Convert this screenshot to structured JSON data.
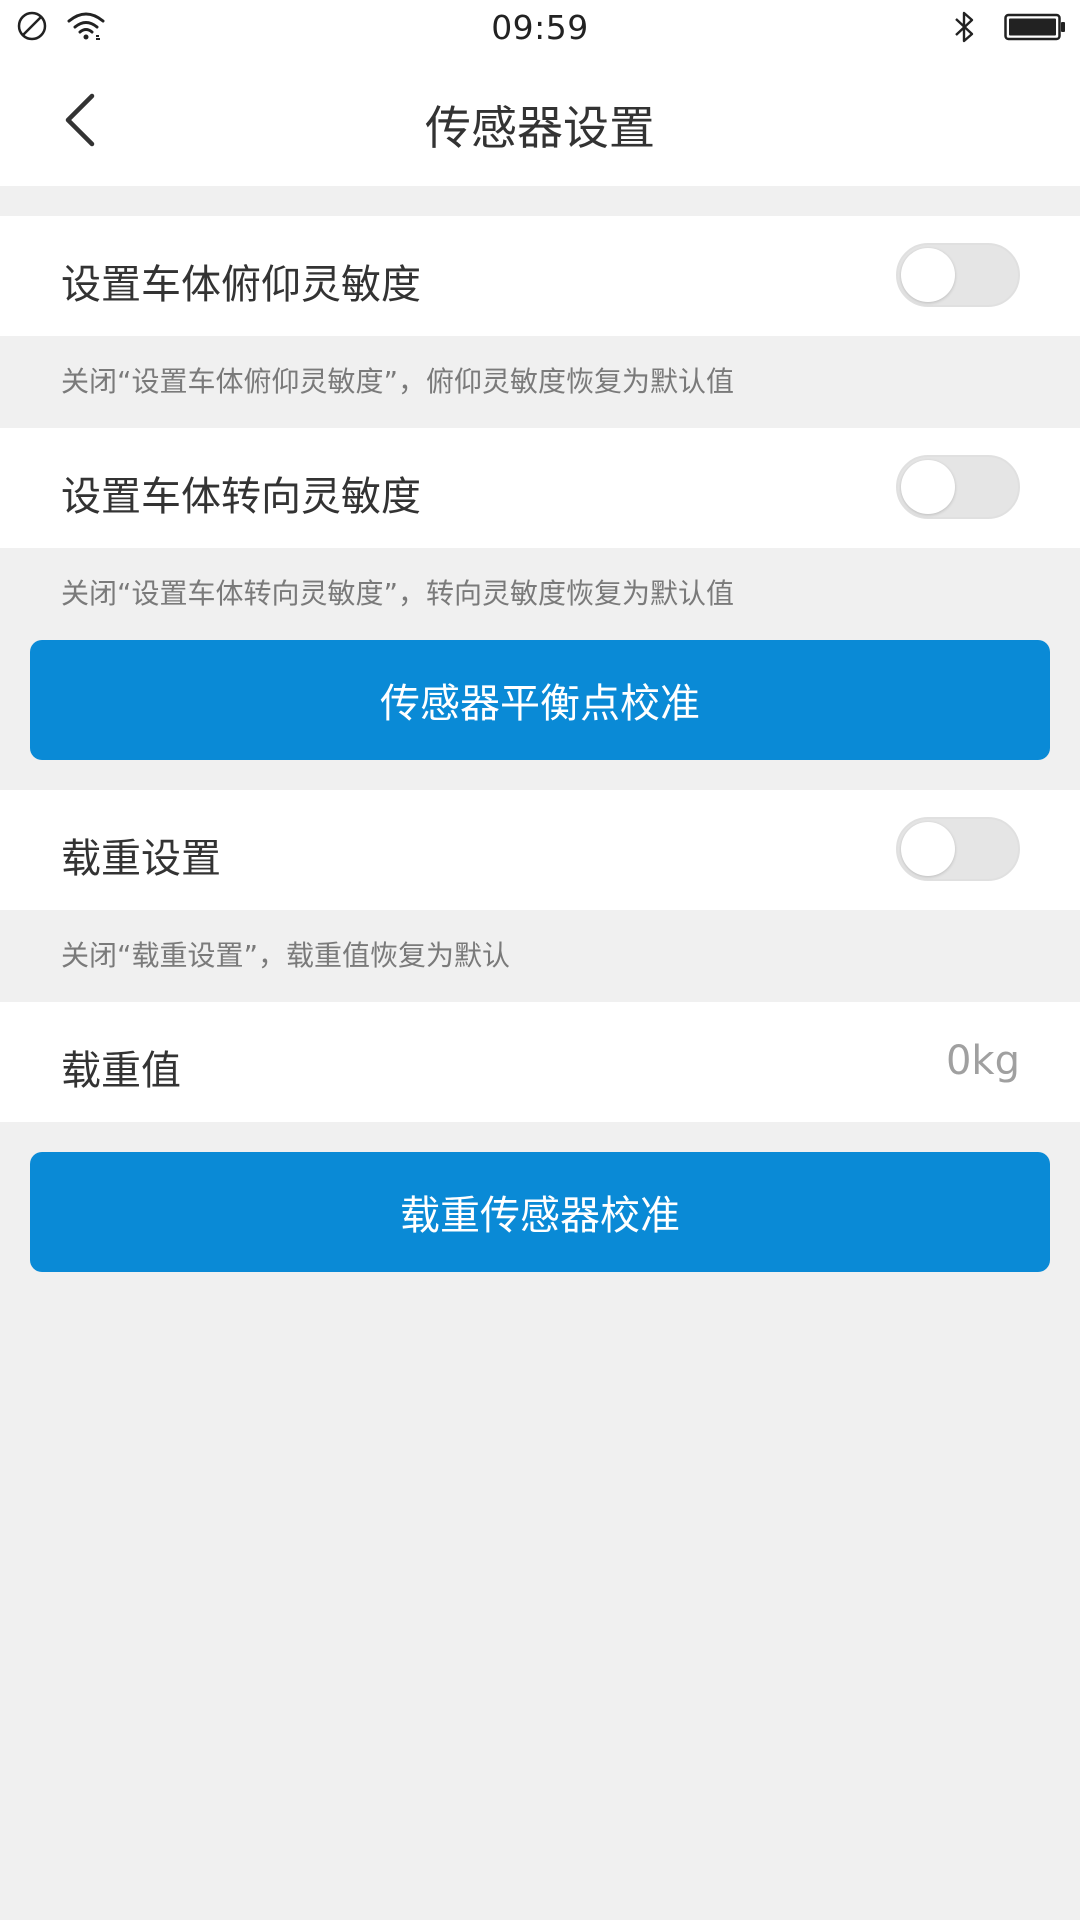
{
  "status_bar": {
    "time": "09:59",
    "icons": [
      "do-not-disturb-icon",
      "wifi-icon",
      "bluetooth-icon",
      "battery-icon"
    ]
  },
  "header": {
    "title": "传感器设置",
    "back_icon": "chevron-left-icon"
  },
  "pitch_sensitivity": {
    "label": "设置车体俯仰灵敏度",
    "enabled": false,
    "hint": "关闭“设置车体俯仰灵敏度”，俯仰灵敏度恢复为默认值"
  },
  "steer_sensitivity": {
    "label": "设置车体转向灵敏度",
    "enabled": false,
    "hint": "关闭“设置车体转向灵敏度”，转向灵敏度恢复为默认值"
  },
  "balance_calibration_button": {
    "label": "传感器平衡点校准"
  },
  "load_setting": {
    "label": "载重设置",
    "enabled": false,
    "hint": "关闭“载重设置”，载重值恢复为默认"
  },
  "load_value": {
    "label": "载重值",
    "value": "0kg"
  },
  "load_calibration_button": {
    "label": "载重传感器校准"
  },
  "colors": {
    "accent": "#0a8ad6",
    "background": "#f0f0f0",
    "card": "#ffffff",
    "hint_text": "#7a7a7a"
  }
}
